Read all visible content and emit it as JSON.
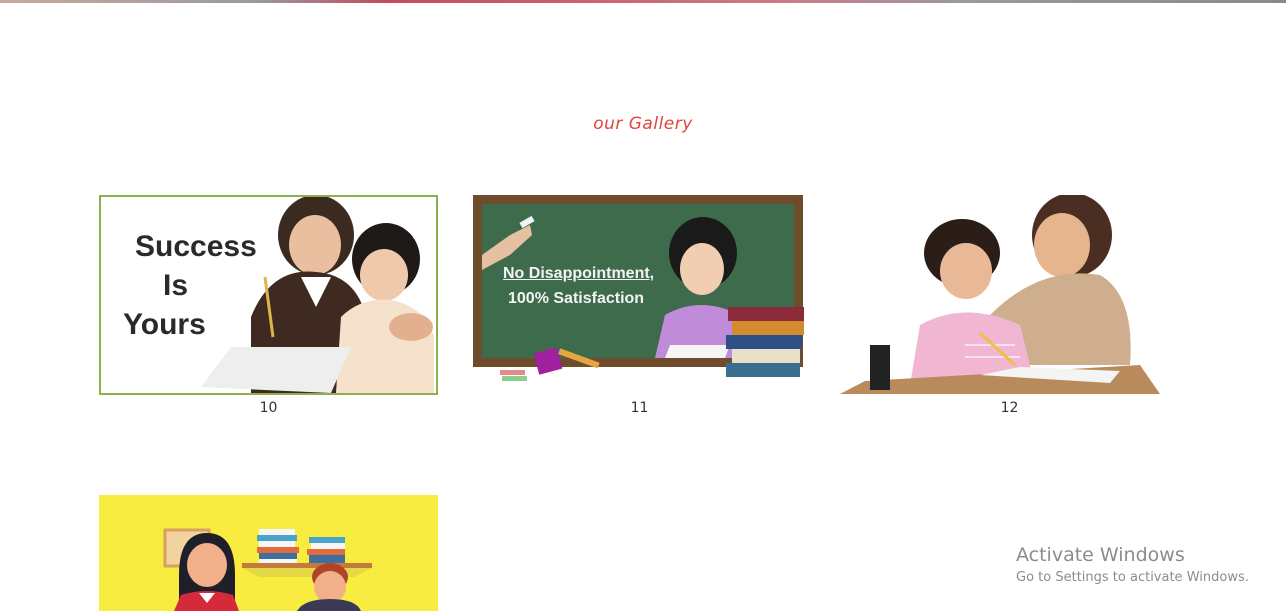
{
  "gallery": {
    "title": "our Gallery",
    "items": [
      {
        "caption": "10",
        "image_text": [
          "Success",
          "Is",
          "Yours"
        ],
        "icon": "tutor-with-student-image"
      },
      {
        "caption": "11",
        "image_text": [
          "No Disappointment,",
          "100% Satisfaction"
        ],
        "icon": "chalkboard-student-image"
      },
      {
        "caption": "12",
        "icon": "teacher-helping-girl-image"
      },
      {
        "icon": "cartoon-teacher-student-image"
      }
    ]
  },
  "watermark": {
    "line1": "Activate Windows",
    "line2": "Go to Settings to activate Windows."
  },
  "colors": {
    "title": "#e0453a",
    "card_border": "#8db04c",
    "chalkboard": "#3e6b4c",
    "yellow_bg": "#f7ec3f"
  }
}
